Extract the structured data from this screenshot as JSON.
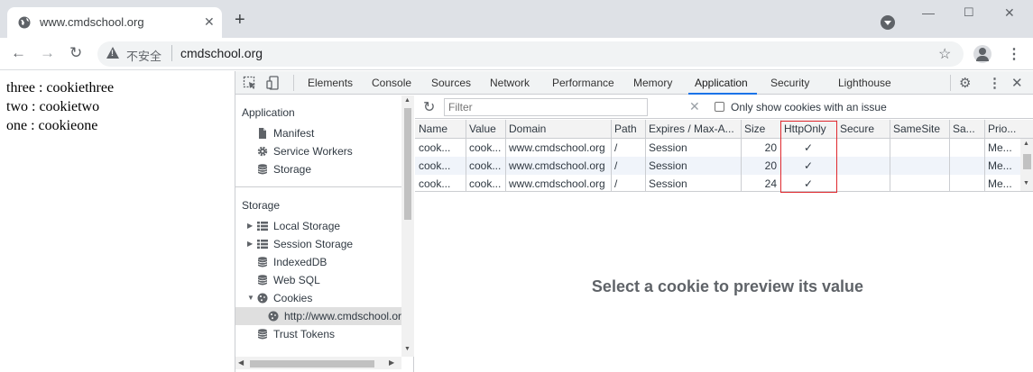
{
  "browser": {
    "tab_title": "www.cmdschool.org",
    "tab_close": "✕",
    "new_tab": "+",
    "window": {
      "minimize": "—",
      "maximize": "☐",
      "close": "✕"
    },
    "nav": {
      "back": "←",
      "forward": "→",
      "reload": "↻"
    },
    "omnibox": {
      "security_label": "不安全",
      "url": "cmdschool.org"
    },
    "bookmark_icon": "☆",
    "menu_icon": "⋮"
  },
  "page": {
    "lines": [
      "three : cookiethree",
      "two : cookietwo",
      "one : cookieone"
    ]
  },
  "devtools": {
    "tabs": [
      "Elements",
      "Console",
      "Sources",
      "Network",
      "Performance",
      "Memory",
      "Application",
      "Security",
      "Lighthouse"
    ],
    "active_tab": "Application",
    "icons": {
      "settings": "⚙",
      "more": "⋮",
      "close": "✕"
    },
    "sidebar": {
      "application_header": "Application",
      "application_items": [
        "Manifest",
        "Service Workers",
        "Storage"
      ],
      "storage_header": "Storage",
      "storage_items": [
        "Local Storage",
        "Session Storage",
        "IndexedDB",
        "Web SQL",
        "Cookies",
        "http://www.cmdschool.org",
        "Trust Tokens"
      ],
      "selected_item": "http://www.cmdschool.org"
    },
    "cookies": {
      "filter_placeholder": "Filter",
      "clear_icon": "✕",
      "only_issue_label": "Only show cookies with an issue",
      "columns": [
        "Name",
        "Value",
        "Domain",
        "Path",
        "Expires / Max-A...",
        "Size",
        "HttpOnly",
        "Secure",
        "SameSite",
        "Sa...",
        "Prio..."
      ],
      "rows": [
        [
          "cook...",
          "cook...",
          "www.cmdschool.org",
          "/",
          "Session",
          "20",
          "✓",
          "",
          "",
          "",
          "Me..."
        ],
        [
          "cook...",
          "cook...",
          "www.cmdschool.org",
          "/",
          "Session",
          "20",
          "✓",
          "",
          "",
          "",
          "Me..."
        ],
        [
          "cook...",
          "cook...",
          "www.cmdschool.org",
          "/",
          "Session",
          "24",
          "✓",
          "",
          "",
          "",
          "Me..."
        ]
      ],
      "highlight_color": "#e0282e",
      "preview_message": "Select a cookie to preview its value"
    }
  }
}
